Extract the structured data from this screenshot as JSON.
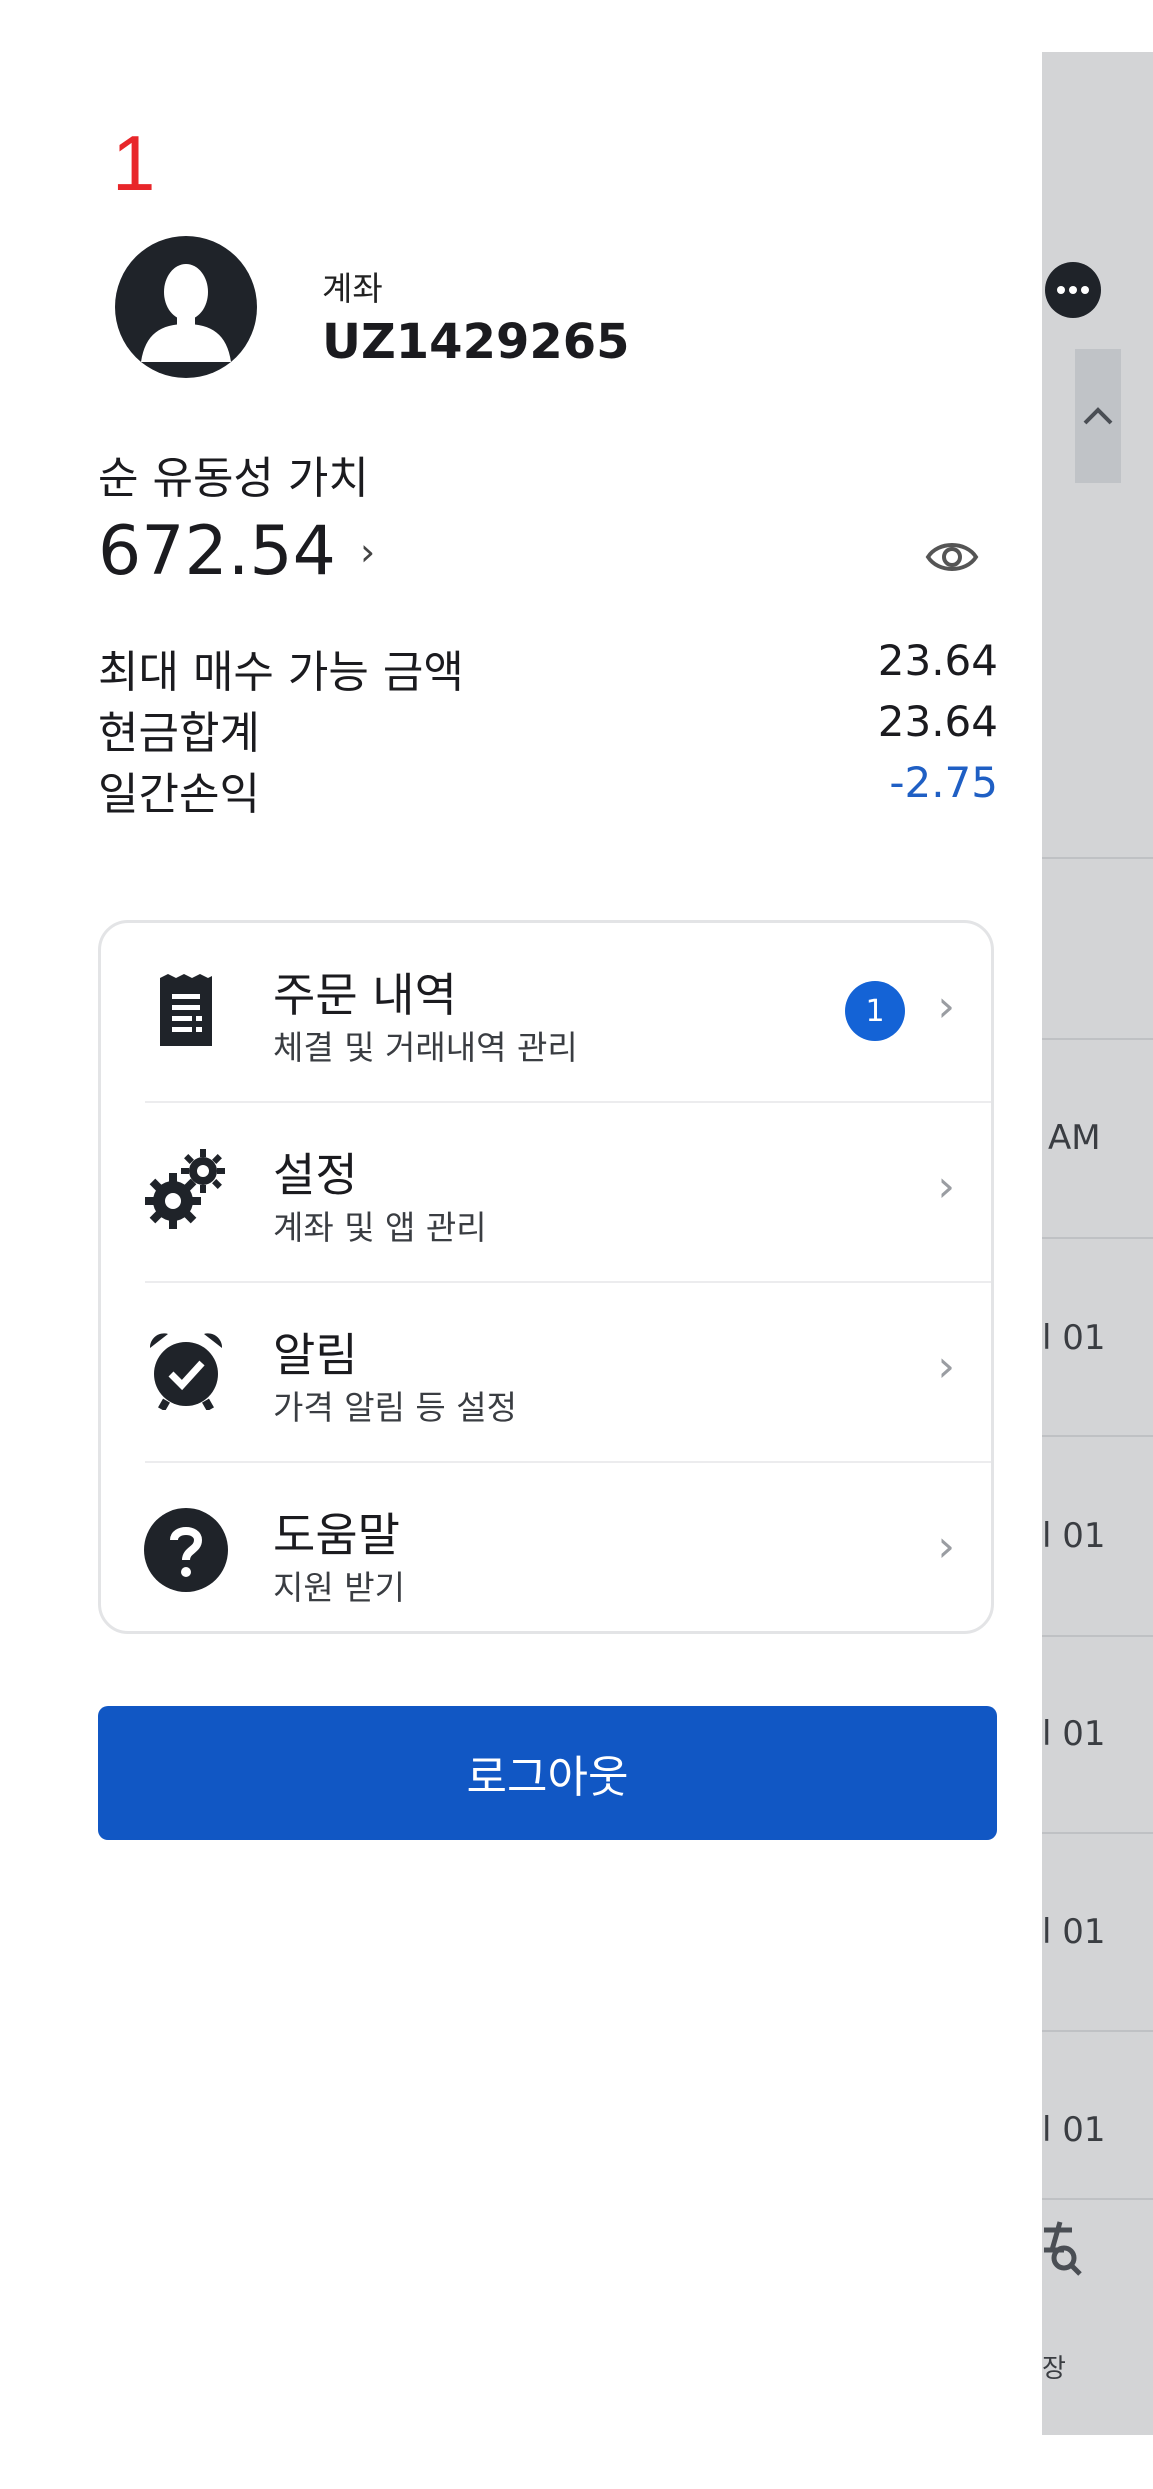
{
  "page_number": "1",
  "account": {
    "label": "계좌",
    "id": "UZ1429265"
  },
  "net_liquidation": {
    "label": "순 유동성 가치",
    "value": "672.54",
    "chevron": "›"
  },
  "summary": [
    {
      "label": "최대 매수 가능 금액",
      "value": "23.64"
    },
    {
      "label": "현금합계",
      "value": "23.64"
    },
    {
      "label": "일간손익",
      "value": "-2.75"
    }
  ],
  "menu": [
    {
      "icon": "receipt-icon",
      "title": "주문 내역",
      "subtitle": "체결 및 거래내역 관리",
      "badge": "1"
    },
    {
      "icon": "gears-icon",
      "title": "설정",
      "subtitle": "계좌 및 앱 관리"
    },
    {
      "icon": "alarm-clock-icon",
      "title": "알림",
      "subtitle": "가격 알림 등 설정"
    },
    {
      "icon": "help-icon",
      "title": "도움말",
      "subtitle": "지원 받기"
    }
  ],
  "logout_label": "로그아웃",
  "background": {
    "rows": [
      "AM",
      "l 01",
      "l 01",
      "l 01",
      "l 01",
      "l 01"
    ],
    "tab_label": "장"
  },
  "colors": {
    "accent": "#1157c4",
    "badge": "#1463d6",
    "negative": "#1f5fc4",
    "page_number": "#e8262a"
  }
}
